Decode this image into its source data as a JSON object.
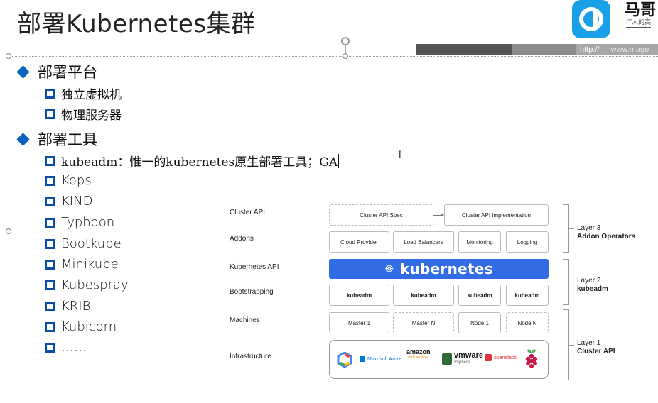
{
  "slide": {
    "title": "部署Kubernetes集群",
    "logo_text": "马哥",
    "logo_sub": "IT人的高",
    "url_left": "http://",
    "url_right": "www.mage"
  },
  "bullets": [
    {
      "label": "部署平台",
      "items": [
        "独立虚拟机",
        "物理服务器"
      ]
    },
    {
      "label": "部署工具",
      "items": [
        "kubeadm：惟一的kubernetes原生部署工具；GA",
        "Kops",
        "KIND",
        "Typhoon",
        "Bootkube",
        "Minikube",
        "Kubespray",
        "KRIB",
        "Kubicorn",
        "……"
      ]
    }
  ],
  "ibeam_glyph": "I",
  "diagram": {
    "row_labels": [
      "Cluster API",
      "Addons",
      "Kubernetes API",
      "Bootstrapping",
      "Machines",
      "Infrastructure"
    ],
    "cluster_api_spec": "Cluster API Spec",
    "cluster_api_impl": "Cluster API Implementation",
    "addons": [
      "Cloud Provider",
      "Load Balancers",
      "Monitoring",
      "Logging"
    ],
    "k8s_wordmark": "kubernetes",
    "bootstrapping": [
      "kubeadm",
      "kubeadm",
      "kubeadm",
      "kubeadm"
    ],
    "machines": [
      "Master 1",
      "Master N",
      "Node 1",
      "Node N"
    ],
    "layers": [
      {
        "name": "Layer 3",
        "detail": "Addon Operators"
      },
      {
        "name": "Layer 2",
        "detail": "kubeadm"
      },
      {
        "name": "Layer 1",
        "detail": "Cluster API"
      }
    ],
    "infra_logos": {
      "azure": "Microsoft Azure",
      "amazon": "amazon",
      "amazon_sub": "web services",
      "vmware": "vmware",
      "vmware_sub": "vSphere",
      "openstack": "openstack"
    }
  },
  "colors": {
    "bullet_blue": "#0b63c1",
    "square_blue": "#0b4ea8",
    "k8s_blue": "#326ce5",
    "logo_blue": "#1aa0e8"
  }
}
